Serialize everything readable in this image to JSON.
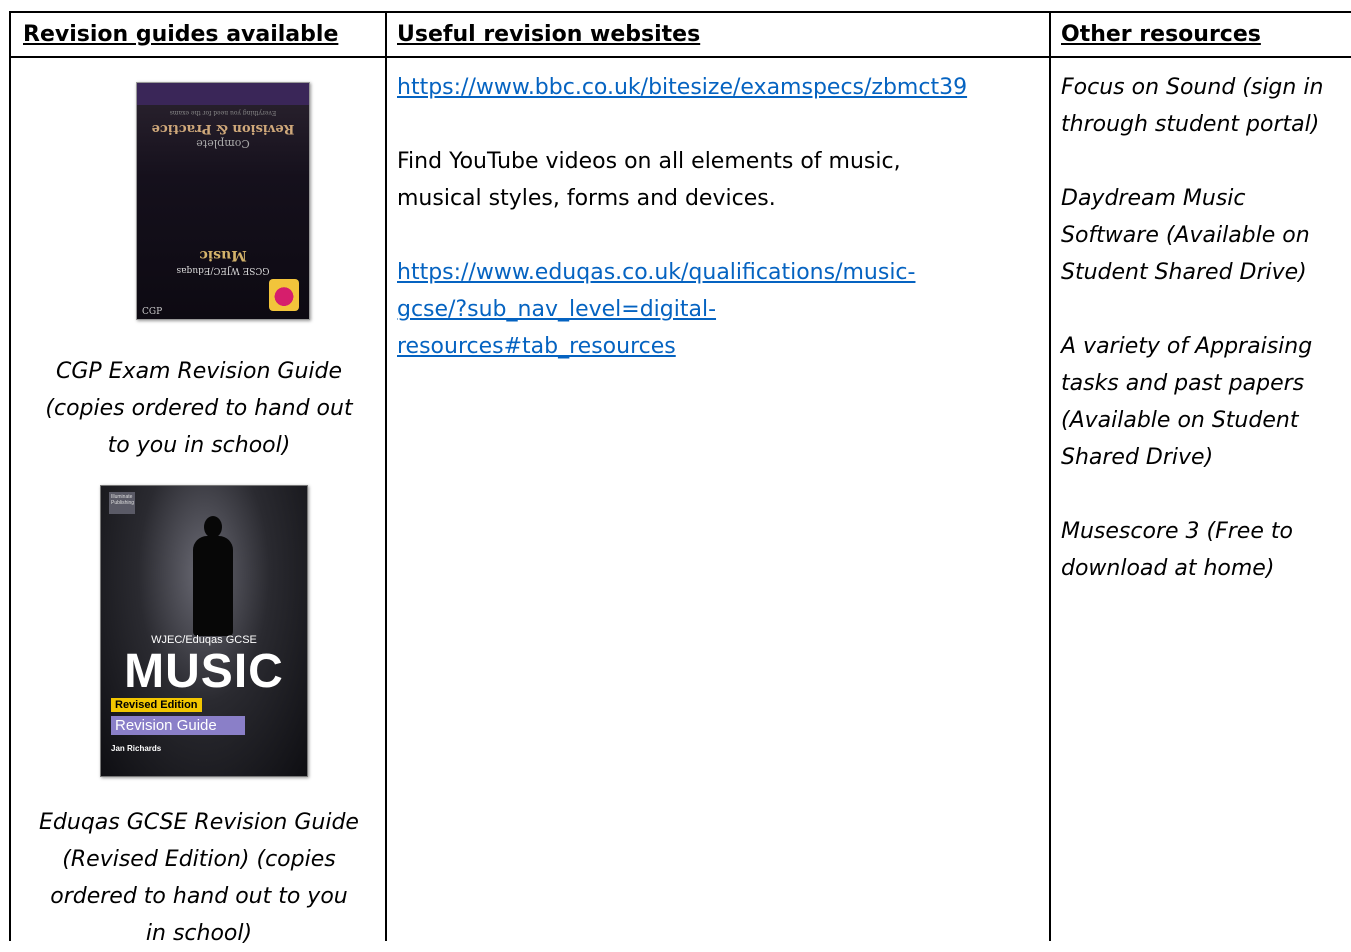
{
  "headers": {
    "col1": "Revision guides available",
    "col2": "Useful revision websites",
    "col3": "Other resources"
  },
  "guides": [
    {
      "caption": [
        "CGP Exam Revision Guide",
        "(copies ordered to hand out",
        "to you in school)"
      ],
      "cover": {
        "title": "Music",
        "subtitle": "GCSE WJEC/Eduqas",
        "series": "Complete",
        "series2": "Revision & Practice",
        "small": "Everything you need for the exams",
        "publisher": "CGP"
      }
    },
    {
      "caption": [
        "Eduqas GCSE Revision Guide",
        "(Revised Edition) (copies",
        "ordered to hand out to you",
        "in school)"
      ],
      "cover": {
        "publisher": "Illuminate Publishing",
        "series": "WJEC/Eduqas GCSE",
        "title": "MUSIC",
        "edition": "Revised Edition",
        "guide": "Revision Guide",
        "author": "Jan Richards"
      }
    }
  ],
  "websites": {
    "link1": "https://www.bbc.co.uk/bitesize/examspecs/zbmct39",
    "text_line1": "Find YouTube videos on all elements of music,",
    "text_line2": "musical styles, forms and devices.",
    "link2_line1": "https://www.eduqas.co.uk/qualifications/music-",
    "link2_line2": "gcse/?sub_nav_level=digital-",
    "link2_line3": "resources#tab_resources"
  },
  "other": [
    [
      "Focus on Sound (sign in",
      "through student portal)"
    ],
    [
      "Daydream Music",
      "Software (Available on",
      "Student Shared Drive)"
    ],
    [
      "A variety of Appraising",
      "tasks and past papers",
      "(Available on Student",
      "Shared Drive)"
    ],
    [
      "Musescore 3 (Free to",
      "download at home)"
    ]
  ],
  "colors": {
    "link": "#0563c1",
    "border": "#000000"
  }
}
